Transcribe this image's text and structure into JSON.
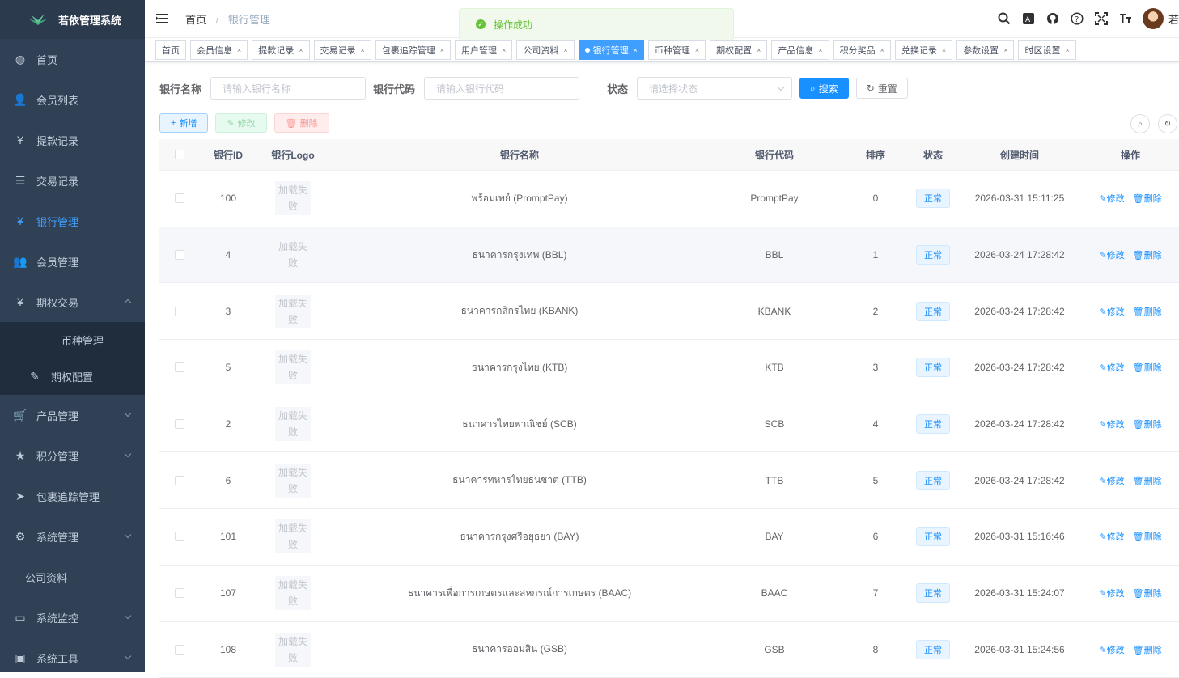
{
  "app": {
    "title": "若依管理系统"
  },
  "sidebar": {
    "items": [
      {
        "label": "首页",
        "icon": "dashboard-icon",
        "glyph": "◍"
      },
      {
        "label": "会员列表",
        "icon": "user-icon",
        "glyph": "👤"
      },
      {
        "label": "提款记录",
        "icon": "yen-icon",
        "glyph": "¥"
      },
      {
        "label": "交易记录",
        "icon": "list-icon",
        "glyph": "☰"
      },
      {
        "label": "银行管理",
        "icon": "yen-icon",
        "glyph": "¥",
        "active": true
      },
      {
        "label": "会员管理",
        "icon": "peoples-icon",
        "glyph": "👥"
      },
      {
        "label": "期权交易",
        "icon": "yen-icon",
        "glyph": "¥",
        "expanded": true
      }
    ],
    "sub_items": [
      {
        "label": "币种管理",
        "icon": "",
        "glyph": ""
      },
      {
        "label": "期权配置",
        "icon": "edit-icon",
        "glyph": "✎"
      }
    ],
    "items_after": [
      {
        "label": "产品管理",
        "icon": "cart-icon",
        "glyph": "🛒",
        "arrow": true
      },
      {
        "label": "积分管理",
        "icon": "star-icon",
        "glyph": "★",
        "arrow": true
      },
      {
        "label": "包裹追踪管理",
        "icon": "send-icon",
        "glyph": "➤",
        "arrow": false
      },
      {
        "label": "系统管理",
        "icon": "gear-icon",
        "glyph": "⚙",
        "arrow": true
      },
      {
        "label": "公司资料",
        "icon": "",
        "glyph": "",
        "arrow": false
      },
      {
        "label": "系统监控",
        "icon": "monitor-icon",
        "glyph": "▭",
        "arrow": true
      },
      {
        "label": "系统工具",
        "icon": "tool-icon",
        "glyph": "▣",
        "arrow": true
      }
    ]
  },
  "header": {
    "breadcrumb_home": "首页",
    "breadcrumb_separator": "/",
    "breadcrumb_current": "银行管理",
    "toast": "操作成功",
    "username": "若"
  },
  "tags": [
    {
      "label": "首页",
      "closable": false
    },
    {
      "label": "会员信息",
      "closable": true
    },
    {
      "label": "提款记录",
      "closable": true
    },
    {
      "label": "交易记录",
      "closable": true
    },
    {
      "label": "包裹追踪管理",
      "closable": true
    },
    {
      "label": "用户管理",
      "closable": true
    },
    {
      "label": "公司资料",
      "closable": true
    },
    {
      "label": "银行管理",
      "closable": true,
      "active": true
    },
    {
      "label": "币种管理",
      "closable": true
    },
    {
      "label": "期权配置",
      "closable": true
    },
    {
      "label": "产品信息",
      "closable": true
    },
    {
      "label": "积分奖品",
      "closable": true
    },
    {
      "label": "兑换记录",
      "closable": true
    },
    {
      "label": "参数设置",
      "closable": true
    },
    {
      "label": "时区设置",
      "closable": true
    }
  ],
  "search": {
    "bank_name_label": "银行名称",
    "bank_name_placeholder": "请输入银行名称",
    "bank_code_label": "银行代码",
    "bank_code_placeholder": "请输入银行代码",
    "status_label": "状态",
    "status_placeholder": "请选择状态",
    "search_btn": "搜索",
    "reset_btn": "重置"
  },
  "toolbar": {
    "add": "新增",
    "edit": "修改",
    "delete": "删除"
  },
  "table": {
    "columns": [
      "银行ID",
      "银行Logo",
      "银行名称",
      "银行代码",
      "排序",
      "状态",
      "创建时间",
      "操作"
    ],
    "logo_fail_text": "加载失败",
    "edit_label": "修改",
    "delete_label": "删除",
    "rows": [
      {
        "id": "100",
        "name": "พร้อมเพย์ (PromptPay)",
        "code": "PromptPay",
        "sort": "0",
        "status": "正常",
        "time": "2026-03-31 15:11:25"
      },
      {
        "id": "4",
        "name": "ธนาคารกรุงเทพ (BBL)",
        "code": "BBL",
        "sort": "1",
        "status": "正常",
        "time": "2026-03-24 17:28:42"
      },
      {
        "id": "3",
        "name": "ธนาคารกสิกรไทย (KBANK)",
        "code": "KBANK",
        "sort": "2",
        "status": "正常",
        "time": "2026-03-24 17:28:42"
      },
      {
        "id": "5",
        "name": "ธนาคารกรุงไทย (KTB)",
        "code": "KTB",
        "sort": "3",
        "status": "正常",
        "time": "2026-03-24 17:28:42"
      },
      {
        "id": "2",
        "name": "ธนาคารไทยพาณิชย์ (SCB)",
        "code": "SCB",
        "sort": "4",
        "status": "正常",
        "time": "2026-03-24 17:28:42"
      },
      {
        "id": "6",
        "name": "ธนาคารทหารไทยธนชาต (TTB)",
        "code": "TTB",
        "sort": "5",
        "status": "正常",
        "time": "2026-03-24 17:28:42"
      },
      {
        "id": "101",
        "name": "ธนาคารกรุงศรีอยุธยา (BAY)",
        "code": "BAY",
        "sort": "6",
        "status": "正常",
        "time": "2026-03-31 15:16:46"
      },
      {
        "id": "107",
        "name": "ธนาคารเพื่อการเกษตรและสหกรณ์การเกษตร (BAAC)",
        "code": "BAAC",
        "sort": "7",
        "status": "正常",
        "time": "2026-03-31 15:24:07"
      },
      {
        "id": "108",
        "name": "ธนาคารออมสิน (GSB)",
        "code": "GSB",
        "sort": "8",
        "status": "正常",
        "time": "2026-03-31 15:24:56"
      }
    ]
  },
  "colors": {
    "sidebar_bg": "#304156",
    "primary": "#1890ff",
    "success": "#67c23a"
  }
}
